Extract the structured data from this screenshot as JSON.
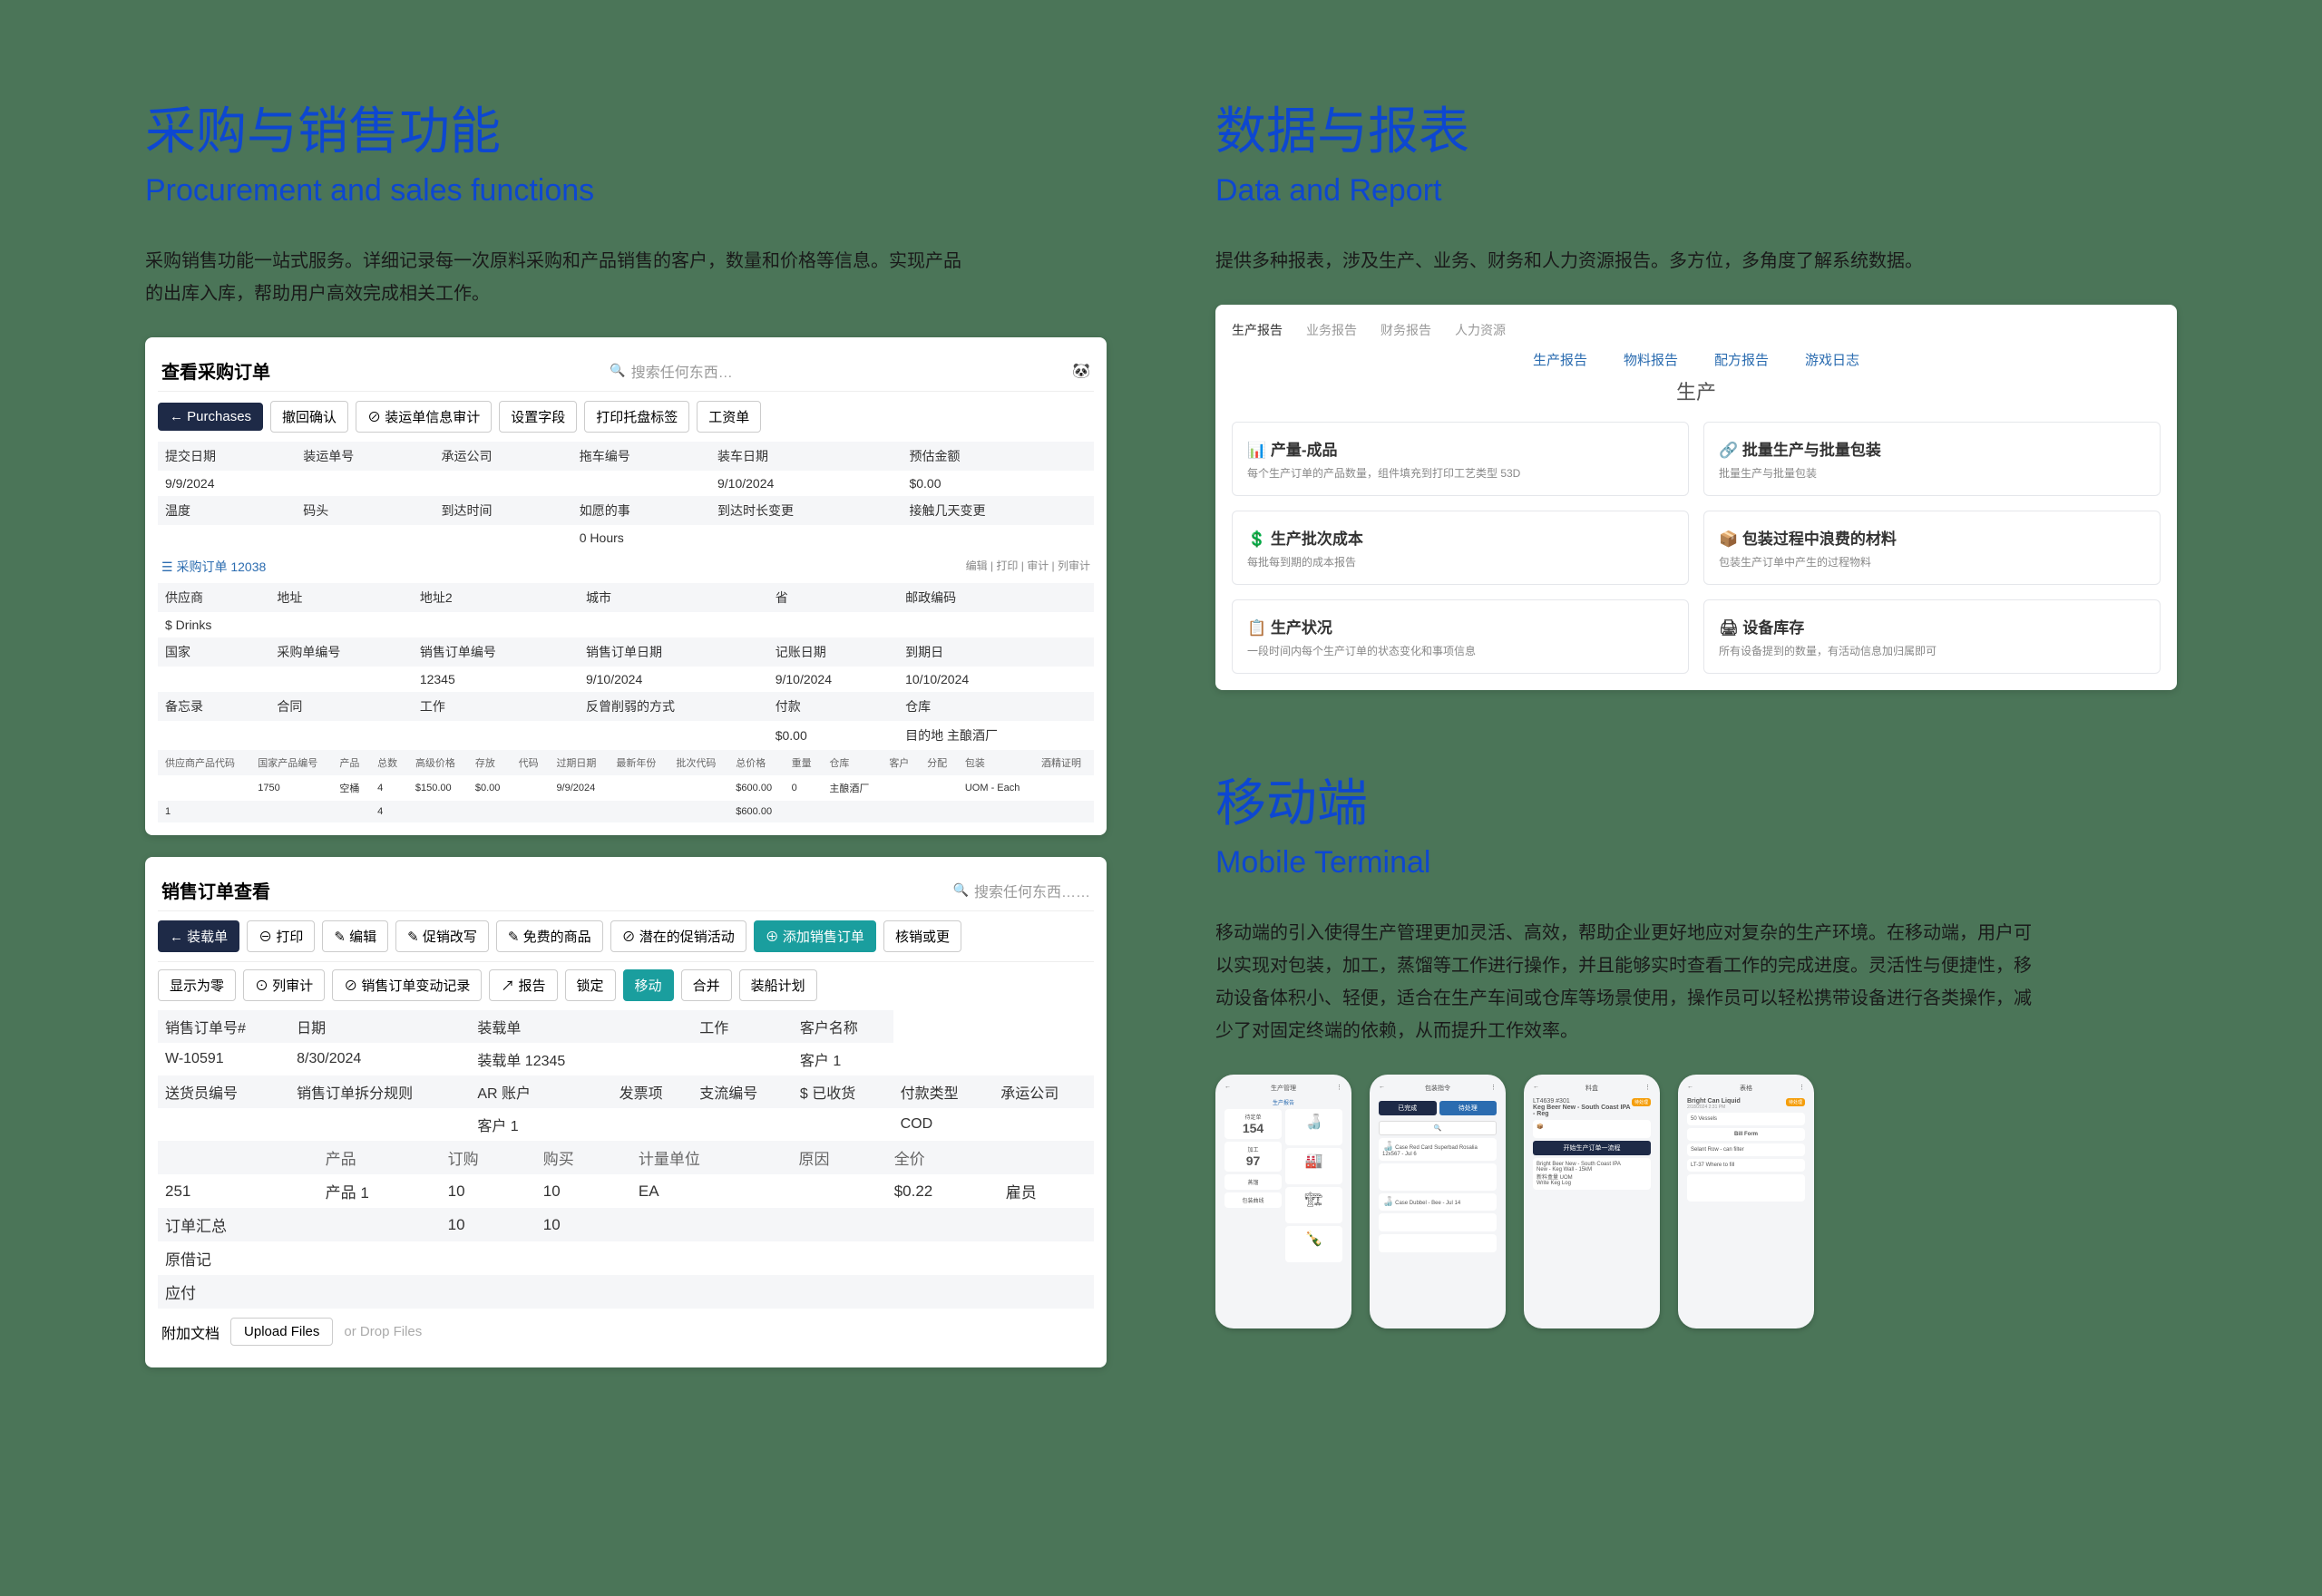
{
  "left": {
    "title_cn": "采购与销售功能",
    "title_en": "Procurement and sales functions",
    "desc": "采购销售功能一站式服务。详细记录每一次原料采购和产品销售的客户，数量和价格等信息。实现产品的出库入库，帮助用户高效完成相关工作。",
    "po": {
      "title": "查看采购订单",
      "search": "搜索任何东西…",
      "btns": [
        "← Purchases",
        "撤回确认",
        "⊘ 装运单信息审计",
        "设置字段",
        "打印托盘标签",
        "工资单"
      ],
      "r1": [
        "提交日期",
        "装运单号",
        "承运公司",
        "拖车编号",
        "装车日期",
        "预估金额"
      ],
      "r1v": [
        "9/9/2024",
        "",
        "",
        "",
        "9/10/2024",
        "$0.00"
      ],
      "r2": [
        "温度",
        "码头",
        "到达时间",
        "如愿的事",
        "到达时长变更",
        "接触几天变更"
      ],
      "r2v": [
        "",
        "",
        "",
        "0 Hours",
        "",
        ""
      ],
      "section": "☰ 采购订单 12038",
      "section_links": "编辑 | 打印 | 审计 | 列审计",
      "r3": [
        "供应商",
        "地址",
        "地址2",
        "城市",
        "省",
        "邮政编码"
      ],
      "r3v": [
        "$ Drinks",
        "",
        "",
        "",
        "",
        ""
      ],
      "r4": [
        "国家",
        "采购单编号",
        "销售订单编号",
        "销售订单日期",
        "记账日期",
        "到期日"
      ],
      "r4v": [
        "",
        "",
        "12345",
        "9/10/2024",
        "9/10/2024",
        "10/10/2024"
      ],
      "r5": [
        "备忘录",
        "合同",
        "工作",
        "反曾削弱的方式",
        "付款",
        "仓库"
      ],
      "r5v": [
        "",
        "",
        "",
        "",
        "$0.00",
        "目的地 主酿酒厂"
      ],
      "dh": [
        "供应商产品代码",
        "国家产品编号",
        "产品",
        "总数",
        "高级价格",
        "存放",
        "代码",
        "过期日期",
        "最新年份",
        "批次代码",
        "总价格",
        "重量",
        "仓库",
        "客户",
        "分配",
        "包装",
        "酒精证明"
      ],
      "dv": [
        "",
        "1750",
        "空桶",
        "4",
        "$150.00",
        "$0.00",
        "",
        "9/9/2024",
        "",
        "",
        "$600.00",
        "0",
        "主酿酒厂",
        "",
        "",
        "UOM - Each",
        ""
      ],
      "total_label": "1",
      "total_qty": "4",
      "total_price": "$600.00"
    },
    "so": {
      "title": "销售订单查看",
      "search": "搜索任何东西……",
      "tb1": [
        "← 装载单",
        "⊖ 打印",
        "✎ 编辑",
        "✎ 促销改写",
        "✎ 免费的商品",
        "⊘ 潜在的促销活动",
        "⊕ 添加销售订单",
        "核销或更"
      ],
      "tb2": [
        "显示为零",
        "⊙ 列审计",
        "⊘ 销售订单变动记录",
        "↗ 报告",
        "锁定",
        "移动",
        "合并",
        "装船计划"
      ],
      "h1": [
        "销售订单号#",
        "日期",
        "装载单",
        "",
        "工作",
        "客户名称"
      ],
      "v1": [
        "W-10591",
        "8/30/2024",
        "装载单 12345",
        "",
        "",
        "客户 1"
      ],
      "h2": [
        "送货员编号",
        "销售订单拆分规则",
        "AR 账户",
        "发票项",
        "支流编号",
        "$ 已收货",
        "付款类型",
        "承运公司"
      ],
      "v2": [
        "",
        "",
        "客户 1",
        "",
        "",
        "",
        "COD",
        ""
      ],
      "ph": [
        "",
        "产品",
        "订购",
        "购买",
        "计量单位",
        "原因",
        "全价",
        ""
      ],
      "pv": [
        "251",
        "产品 1",
        "10",
        "10",
        "EA",
        "",
        "$0.22",
        "雇员"
      ],
      "sum_label": "订单汇总",
      "sum_v": [
        "10",
        "10"
      ],
      "tax": "原借记",
      "pay": "应付",
      "attach": "附加文档",
      "upload": "Upload Files",
      "drop": "or Drop Files"
    }
  },
  "right": {
    "title_cn": "数据与报表",
    "title_en": "Data and Report",
    "desc": "提供多种报表，涉及生产、业务、财务和人力资源报告。多方位，多角度了解系统数据。",
    "tabs": [
      "生产报告",
      "业务报告",
      "财务报告",
      "人力资源"
    ],
    "subtabs": [
      "生产报告",
      "物料报告",
      "配方报告",
      "游戏日志"
    ],
    "head": "生产",
    "cards": [
      {
        "t": "📊 产量-成品",
        "d": "每个生产订单的产品数量，组件填充到打印工艺类型 53D"
      },
      {
        "t": "🔗 批量生产与批量包装",
        "d": "批量生产与批量包装"
      },
      {
        "t": "💲 生产批次成本",
        "d": "每批每到期的成本报告"
      },
      {
        "t": "📦 包装过程中浪费的材料",
        "d": "包装生产订单中产生的过程物料"
      },
      {
        "t": "📋 生产状况",
        "d": "一段时间内每个生产订单的状态变化和事项信息"
      },
      {
        "t": "🖨 设备库存",
        "d": "所有设备提到的数量，有活动信息加归属即可"
      }
    ],
    "m_title_cn": "移动端",
    "m_title_en": "Mobile Terminal",
    "m_desc": "移动端的引入使得生产管理更加灵活、高效，帮助企业更好地应对复杂的生产环境。在移动端，用户可以实现对包装，加工，蒸馏等工作进行操作，并且能够实时查看工作的完成进度。灵活性与便捷性，移动设备体积小、轻便，适合在生产车间或仓库等场景使用，操作员可以轻松携带设备进行各类操作，减少了对固定终端的依赖，从而提升工作效率。",
    "p1": {
      "title": "生产管理",
      "sub": "生产报告",
      "k1": "待定单",
      "v1": "154",
      "k2": "加工",
      "v2": "97",
      "k3": "蒸馏",
      "k4": "包装曲线"
    },
    "p2": {
      "title": "包装指令",
      "btn1": "已完成",
      "btn2": "待处理",
      "items": [
        "Case Red Card Superbad Rosalia 12x567 - Jul 6",
        "Case Dubbel - Bee - Jul 14"
      ]
    },
    "p3": {
      "title": "料盒",
      "t": "Keg Beer New - South Coast IPA - Reg",
      "code": "LT4639 #301",
      "btn": "开始生产订单一流程",
      "l2": "Bright Beer New - South Coast IPA",
      "l3": "New - Keg Wall - 15kM",
      "l4": "新料盒量 UOM",
      "l5": "Write Keg Log"
    },
    "p4": {
      "title": "表格",
      "t": "Bright Can Liquid",
      "d": "2/18/2024 2:31 PM",
      "f1": "50 Vessels",
      "f2": "Bill Form",
      "f3": "Selant Row - can filter",
      "f4": "LT-37 Where to fill"
    }
  }
}
